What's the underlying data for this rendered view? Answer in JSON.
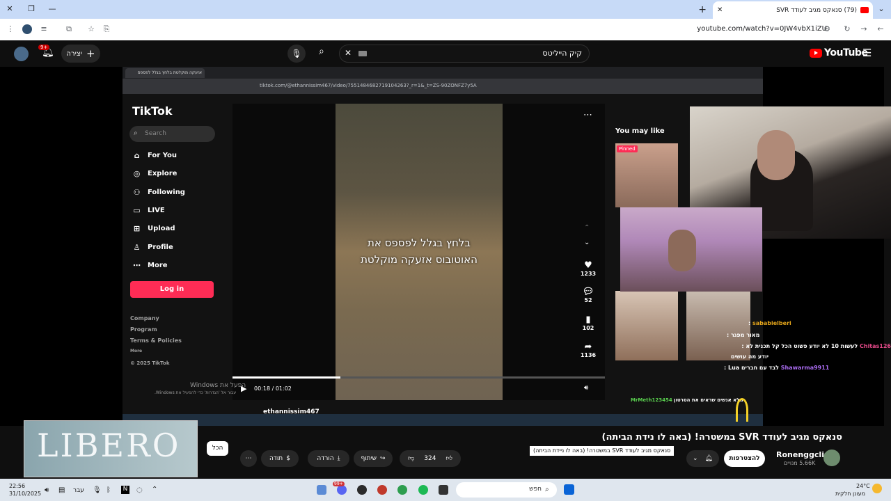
{
  "browser": {
    "tab_title": "(79) סנאקס מגיב לעודד SVR",
    "new_tab": "+",
    "url": "youtube.com/watch?v=0JW4vbX1iZU"
  },
  "youtube": {
    "create_label": "יצירה",
    "notif_badge": "9+",
    "search_query": "קיק הייליטס",
    "logo": "YouTube"
  },
  "inner_browser": {
    "tab_title": "אזעקה מוקלטת בלחץ בגלל לפספס",
    "url": "tiktok.com/@ethannissim467/video/7551484682719104263?_r=1&_t=ZS-90ZONFZ7y5A"
  },
  "tiktok": {
    "logo": "TikTok",
    "search_placeholder": "Search",
    "nav": [
      {
        "label": "For You",
        "icon": "home-icon"
      },
      {
        "label": "Explore",
        "icon": "compass-icon"
      },
      {
        "label": "Following",
        "icon": "following-icon"
      },
      {
        "label": "LIVE",
        "icon": "live-icon"
      },
      {
        "label": "Upload",
        "icon": "upload-icon"
      },
      {
        "label": "Profile",
        "icon": "profile-icon"
      },
      {
        "label": "More",
        "icon": "more-icon"
      }
    ],
    "login": "Log in",
    "footer": [
      "Company",
      "Program",
      "Terms & Policies",
      "More",
      "© 2025 TikTok"
    ],
    "overlay_line1": "בלחץ בגלל לפספס את",
    "overlay_line2": "האוטובוס אזעקה מוקלטת",
    "time": "00:18 / 01:02",
    "progress": 0.29,
    "likes": "1233",
    "comments": "52",
    "saves": "102",
    "shares": "1136",
    "you_may_like": "You may like",
    "pinned": "Pinned",
    "author": "ethannissim467"
  },
  "chat": [
    {
      "user": "sababielberi",
      "text": ":",
      "color": "#e3a41a"
    },
    {
      "user": "",
      "text": "מאור מפגר :",
      "color": "#fff"
    },
    {
      "user": "Chitas126",
      "text": "לעשות 10 לא יודע פשוט הכל קל תכנית לא :",
      "color": "#e64a8a"
    },
    {
      "user": "",
      "text": "יודע מה עושים",
      "color": "#fff"
    },
    {
      "user": "Shawarma9911",
      "text": "לבד עם חברים Lua :",
      "color": "#a96bf0"
    },
    {
      "user": "MrMeth123454",
      "text": "מלא אנשים שראים את הסרטון",
      "color": "#5ad14f"
    }
  ],
  "video": {
    "title": "סנאקס מגיב לעודד SVR במשטרה! (באה לו נידת הביתה)",
    "tooltip": "סנאקס מגיב לעודד SVR במשטרה! (באה לו ניידת הביתה)",
    "channel": "Ronenggclip",
    "subscribers": "5.66K מנויים",
    "subscribe": "להצטרפות",
    "like_count": "324",
    "share": "שיתוף",
    "download": "הורדה",
    "thanks": "תודה",
    "all_label": "הכל"
  },
  "ad": {
    "brand": "LIBERO"
  },
  "windows_watermark": {
    "line1": "הפעל את Windows",
    "line2": "עבור אל 'הגדרות' כדי להפעיל את Windows."
  },
  "taskbar": {
    "time": "22:56",
    "date": "31/10/2025",
    "lang": "עבר",
    "search": "חפש",
    "weather_temp": "24°C",
    "weather_text": "מעונן חלקית",
    "badge": "99+"
  },
  "colors": {
    "yt_red": "#ff0000",
    "tiktok_pink": "#fe2c55"
  }
}
